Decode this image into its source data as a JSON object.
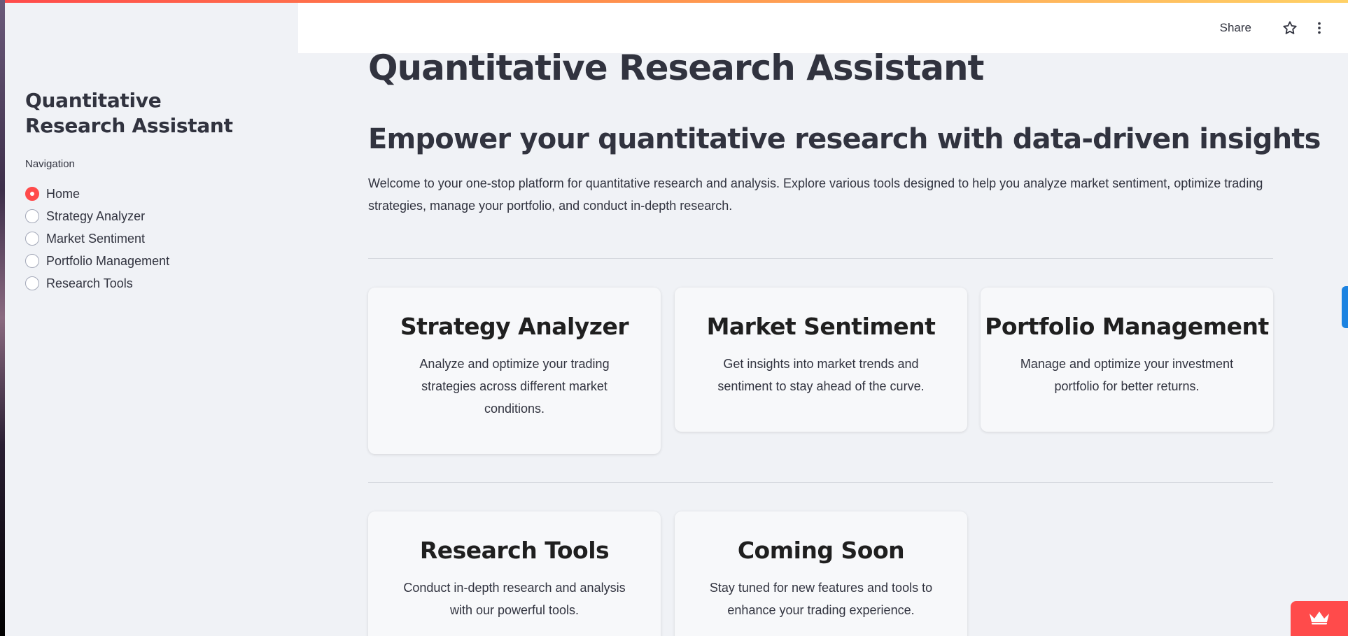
{
  "sidebar": {
    "title": "Quantitative Research Assistant",
    "nav_caption": "Navigation",
    "items": [
      {
        "label": "Home",
        "selected": true
      },
      {
        "label": "Strategy Analyzer",
        "selected": false
      },
      {
        "label": "Market Sentiment",
        "selected": false
      },
      {
        "label": "Portfolio Management",
        "selected": false
      },
      {
        "label": "Research Tools",
        "selected": false
      }
    ]
  },
  "header": {
    "share_label": "Share",
    "star_icon": "star-icon",
    "menu_icon": "kebab-menu-icon"
  },
  "main": {
    "title": "Quantitative Research Assistant",
    "subtitle": "Empower your quantitative research with data-driven insights",
    "intro": "Welcome to your one-stop platform for quantitative research and analysis. Explore various tools designed to help you analyze market sentiment, optimize trading strategies, manage your portfolio, and conduct in-depth research.",
    "cards": [
      {
        "title": "Strategy Analyzer",
        "description": "Analyze and optimize your trading strategies across different market conditions."
      },
      {
        "title": "Market Sentiment",
        "description": "Get insights into market trends and sentiment to stay ahead of the curve."
      },
      {
        "title": "Portfolio Management",
        "description": "Manage and optimize your investment portfolio for better returns."
      },
      {
        "title": "Research Tools",
        "description": "Conduct in-depth research and analysis with our powerful tools."
      },
      {
        "title": "Coming Soon",
        "description": "Stay tuned for new features and tools to enhance your trading experience."
      }
    ]
  },
  "colors": {
    "accent": "#ff4b4b",
    "background": "#f0f2f6",
    "text": "#31333f"
  }
}
